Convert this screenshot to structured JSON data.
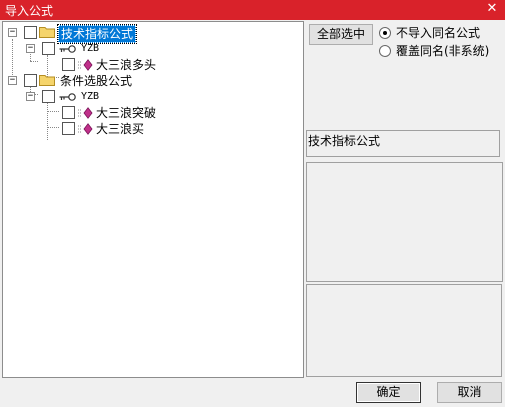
{
  "window": {
    "title": "导入公式",
    "close_glyph": "✕"
  },
  "tree": {
    "root1": {
      "label": "技术指标公式",
      "expander": "−"
    },
    "root1_group": {
      "label": "YZB",
      "expander": "−"
    },
    "root1_item1": {
      "label": "大三浪多头"
    },
    "root2": {
      "label": "条件选股公式",
      "expander": "−"
    },
    "root2_group": {
      "label": "YZB",
      "expander": "−"
    },
    "root2_item1": {
      "label": "大三浪突破"
    },
    "root2_item2": {
      "label": "大三浪买"
    }
  },
  "options": {
    "select_all_label": "全部选中",
    "radio_skip_label": "不导入同名公式",
    "radio_overwrite_label": "覆盖同名(非系统)",
    "selected_radio": "skip"
  },
  "info": {
    "type_label": "技术指标公式"
  },
  "buttons": {
    "ok_label": "确定",
    "cancel_label": "取消"
  },
  "colors": {
    "titlebar": "#d9222a",
    "selection": "#0078d7",
    "folder": "#f5d46b",
    "formula": "#c0308a"
  }
}
